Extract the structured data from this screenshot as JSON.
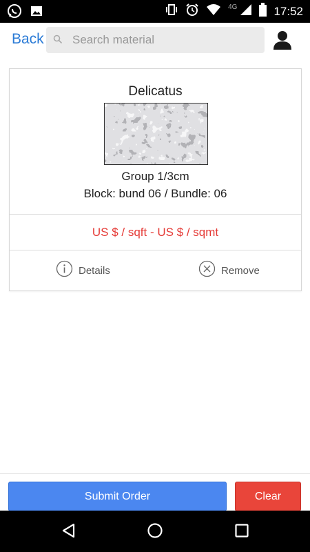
{
  "status_bar": {
    "time": "17:52",
    "network_type": "4G"
  },
  "header": {
    "back_label": "Back",
    "search_placeholder": "Search material",
    "search_value": ""
  },
  "item": {
    "name": "Delicatus",
    "group": "Group 1/3cm",
    "block_bundle": "Block: bund 06 / Bundle: 06",
    "price": "US $ / sqft - US $ / sqmt",
    "details_label": "Details",
    "remove_label": "Remove"
  },
  "actions": {
    "submit_label": "Submit Order",
    "clear_label": "Clear"
  },
  "colors": {
    "link_blue": "#2b7bd6",
    "price_red": "#e53935",
    "submit_blue": "#4b87f0",
    "clear_red": "#e9453a"
  }
}
